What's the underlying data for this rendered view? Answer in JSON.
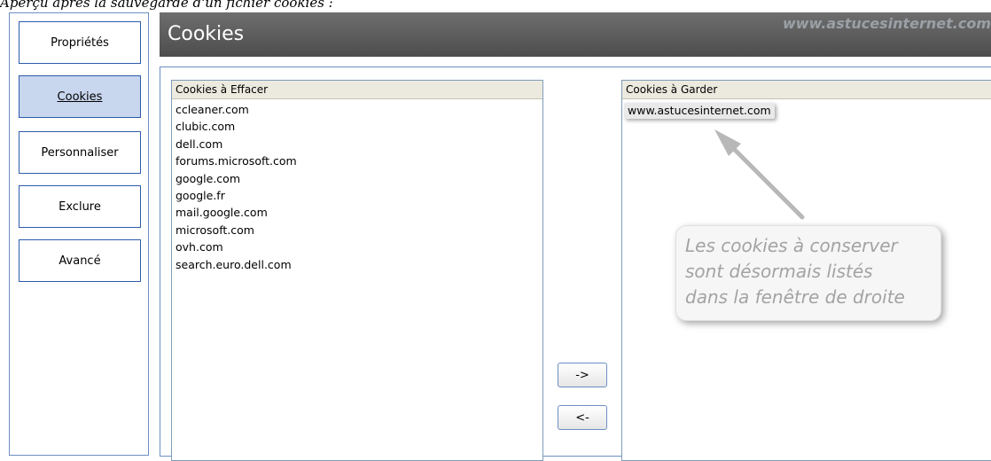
{
  "caption": "Aperçu après la sauvegarde d'un fichier cookies :",
  "sidebar": {
    "items": [
      {
        "label": "Propriétés",
        "active": false
      },
      {
        "label": "Cookies",
        "active": true
      },
      {
        "label": "Personnaliser",
        "active": false
      },
      {
        "label": "Exclure",
        "active": false
      },
      {
        "label": "Avancé",
        "active": false
      }
    ]
  },
  "header": {
    "title": "Cookies",
    "watermark": "www.astucesinternet.com"
  },
  "erase_list": {
    "header": "Cookies à Effacer",
    "items": [
      "ccleaner.com",
      "clubic.com",
      "dell.com",
      "forums.microsoft.com",
      "google.com",
      "google.fr",
      "mail.google.com",
      "microsoft.com",
      "ovh.com",
      "search.euro.dell.com"
    ]
  },
  "keep_list": {
    "header": "Cookies à Garder",
    "items": [
      "www.astucesinternet.com"
    ]
  },
  "buttons": {
    "move_right": "->",
    "move_left": "<-"
  },
  "callout": {
    "text": "Les cookies à conserver\nsont désormais listés\ndans la fenêtre de droite"
  },
  "colors": {
    "header_bg": "#5e5e5e",
    "active_nav_bg": "#c8d6ee",
    "border_blue": "#2d5cab"
  }
}
